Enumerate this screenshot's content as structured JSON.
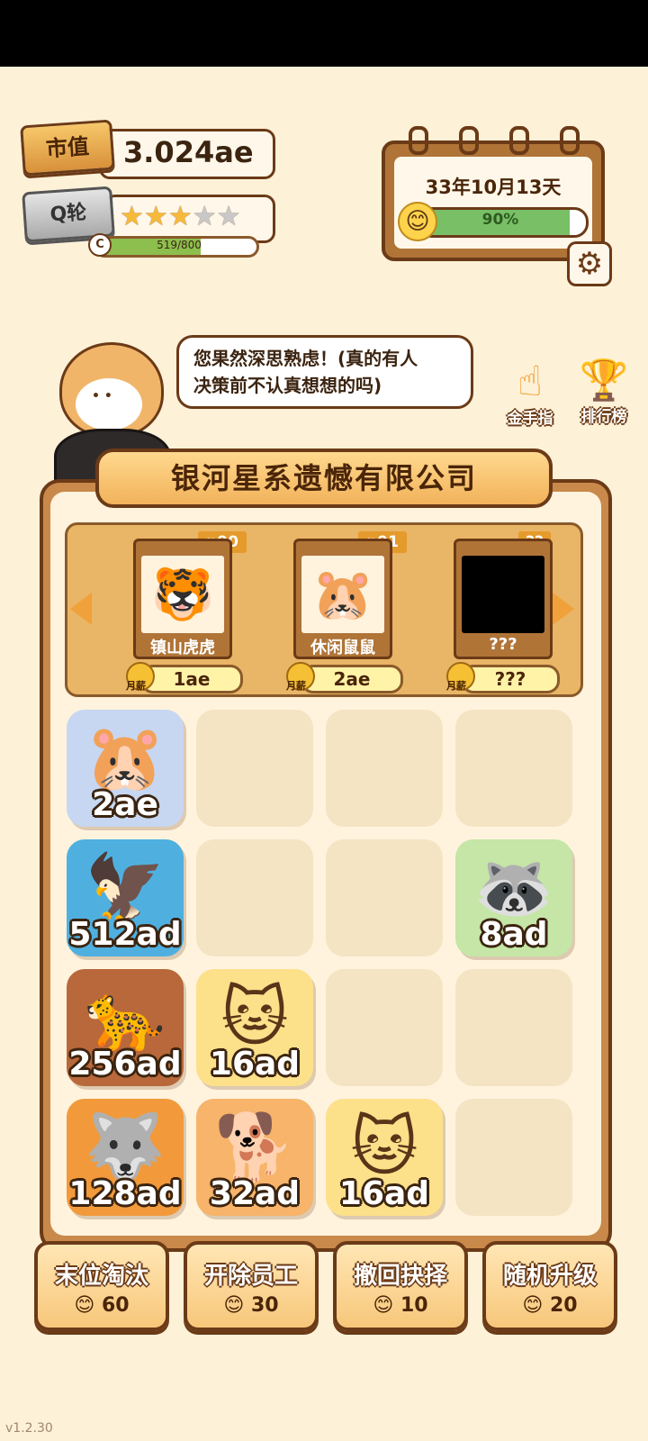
{
  "stats": {
    "market_value_label": "市值",
    "market_value": "3.024ae",
    "round_label": "Q轮",
    "stars_filled": 3,
    "stars_total": 5,
    "level_grade": "C",
    "xp_text": "519/800",
    "xp_fraction": 0.65
  },
  "calendar": {
    "date": "33年10月13天",
    "mood_percent": "90%",
    "mood_fraction": 0.9,
    "mood_icon": "smile-face-icon",
    "settings_icon": "gear-icon"
  },
  "speech": {
    "text_line1": "您果然深思熟虑！(真的有人",
    "text_line2": "决策前不认真想想的吗)"
  },
  "side_buttons": {
    "golden_finger": "金手指",
    "leaderboard": "排行榜"
  },
  "company": {
    "name": "银河星系遗憾有限公司"
  },
  "candidates": [
    {
      "name": "镇山虎虎",
      "level": "p90",
      "salary_label": "月薪",
      "salary": "1ae",
      "icon": "🐯"
    },
    {
      "name": "休闲鼠鼠",
      "level": "p91",
      "salary_label": "月薪",
      "salary": "2ae",
      "icon": "🐹"
    },
    {
      "name": "???",
      "level": "??",
      "salary_label": "月薪",
      "salary": "???",
      "icon": "🐿"
    }
  ],
  "grid": [
    {
      "value": "2ae",
      "icon": "🐹",
      "color": "#c7d7f2"
    },
    null,
    null,
    null,
    {
      "value": "512ad",
      "icon": "🦅",
      "color": "#4fb0e0"
    },
    null,
    null,
    {
      "value": "8ad",
      "icon": "🦝",
      "color": "#c5e6a6"
    },
    {
      "value": "256ad",
      "icon": "🐆",
      "color": "#b8683a"
    },
    {
      "value": "16ad",
      "icon": "🐱",
      "color": "#fde08a"
    },
    null,
    null,
    {
      "value": "128ad",
      "icon": "🐺",
      "color": "#f29a3b"
    },
    {
      "value": "32ad",
      "icon": "🐕",
      "color": "#f7b46a"
    },
    {
      "value": "16ad",
      "icon": "🐱",
      "color": "#fde08a"
    },
    null
  ],
  "actions": [
    {
      "label": "末位淘汰",
      "cost": "60"
    },
    {
      "label": "开除员工",
      "cost": "30"
    },
    {
      "label": "撤回抉择",
      "cost": "10"
    },
    {
      "label": "随机升级",
      "cost": "20"
    }
  ],
  "version": "v1.2.30"
}
